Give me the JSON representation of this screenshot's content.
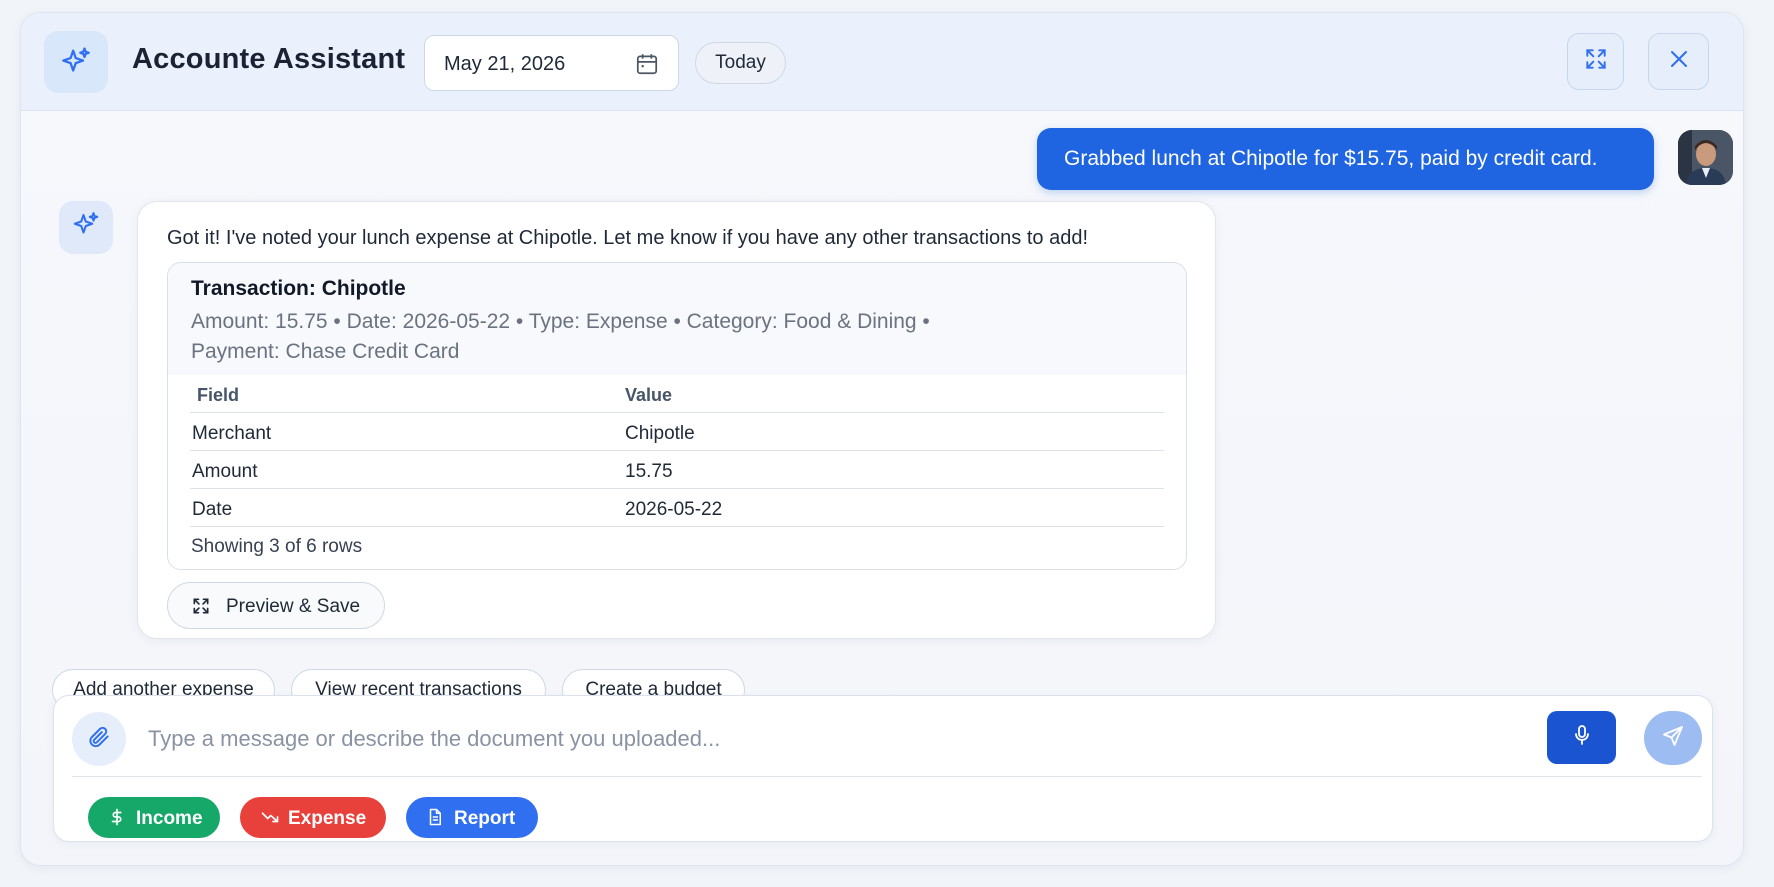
{
  "header": {
    "title": "Accounte Assistant",
    "date_value": "May 21, 2026",
    "today_label": "Today",
    "icons": {
      "logo": "sparkle-icon",
      "calendar": "calendar-icon",
      "expand": "expand-icon",
      "close": "close-icon"
    }
  },
  "conversation": {
    "user_message": "Grabbed lunch at Chipotle for $15.75, paid by credit card.",
    "bot_message": "Got it! I've noted your lunch expense at Chipotle. Let me know if you have any other transactions to add!",
    "transaction": {
      "title": "Transaction: Chipotle",
      "meta_line1": "Amount: 15.75 • Date: 2026-05-22 • Type: Expense • Category: Food & Dining •",
      "meta_line2": "Payment: Chase Credit Card",
      "columns": [
        "Field",
        "Value"
      ],
      "rows": [
        [
          "Merchant",
          "Chipotle"
        ],
        [
          "Amount",
          "15.75"
        ],
        [
          "Date",
          "2026-05-22"
        ]
      ],
      "footer": "Showing 3 of 6 rows"
    },
    "preview_label": "Preview & Save"
  },
  "suggestions": [
    "Add another expense",
    "View recent transactions",
    "Create a budget"
  ],
  "composer": {
    "placeholder": "Type a message or describe the document you uploaded...",
    "pills": [
      {
        "label": "Income",
        "icon": "dollar-icon",
        "color": "#16a868"
      },
      {
        "label": "Expense",
        "icon": "trend-down-icon",
        "color": "#e8413c"
      },
      {
        "label": "Report",
        "icon": "document-icon",
        "color": "#2f6ff0"
      }
    ]
  },
  "colors": {
    "accent": "#1f64e0",
    "mic": "#1b54d1",
    "send_disabled": "#9dbdf2"
  }
}
